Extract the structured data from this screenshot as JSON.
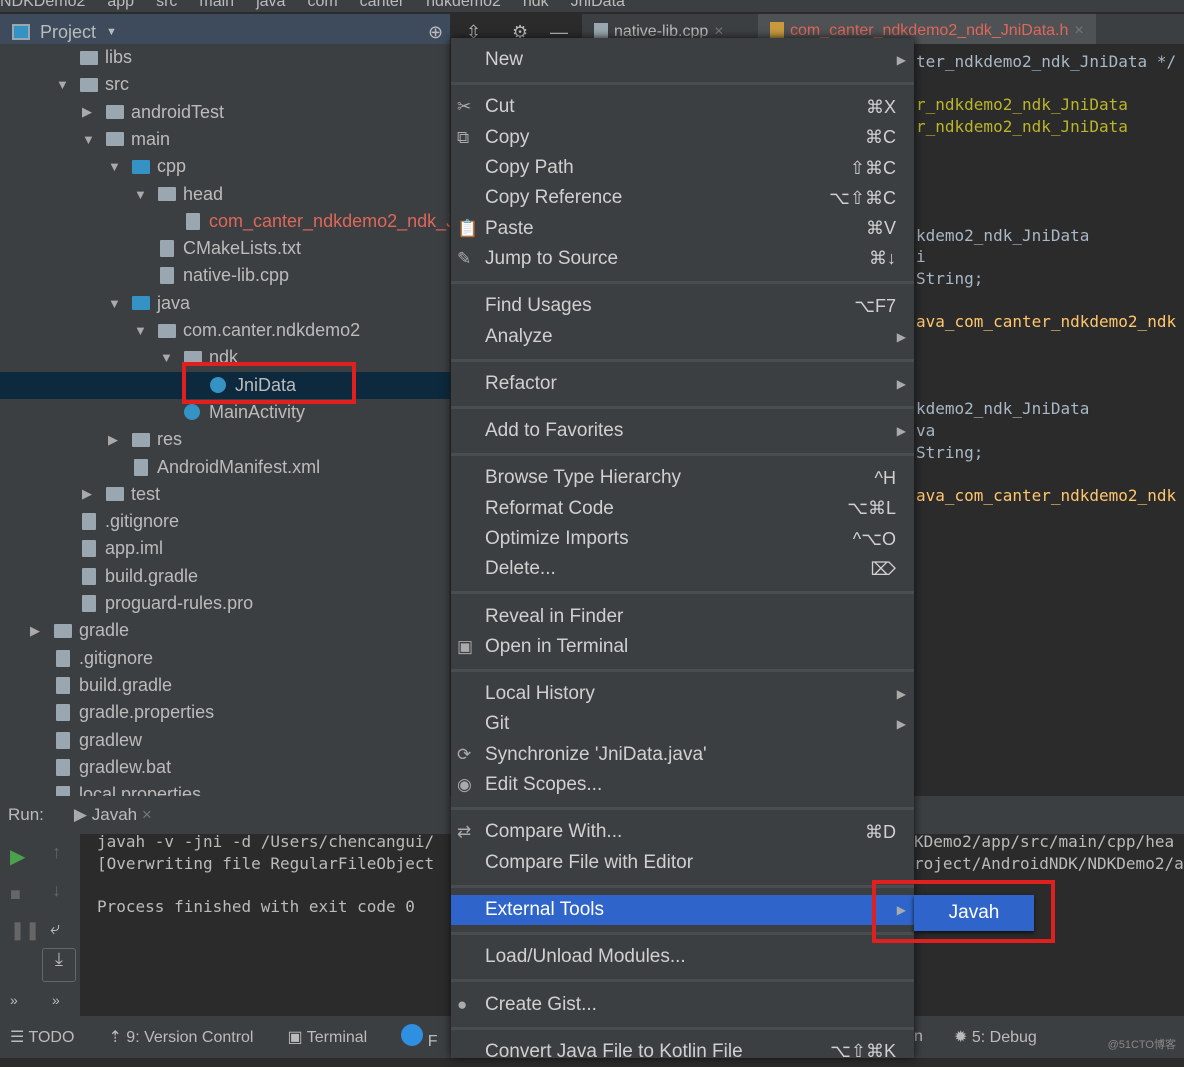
{
  "breadcrumbs": [
    "NDKDemo2",
    "app",
    "src",
    "main",
    "java",
    "com",
    "canter",
    "ndkdemo2",
    "ndk",
    "JniData"
  ],
  "project_panel": {
    "title": "Project"
  },
  "editor_tabs": [
    {
      "label": "native-lib.cpp",
      "active": false
    },
    {
      "label": "com_canter_ndkdemo2_ndk_JniData.h",
      "active": true,
      "color": "#e0665a"
    }
  ],
  "tree": [
    {
      "label": "libs",
      "depth": 2,
      "arrow": ""
    },
    {
      "label": "src",
      "depth": 2,
      "arrow": "▼"
    },
    {
      "label": "androidTest",
      "depth": 3,
      "arrow": "▶"
    },
    {
      "label": "main",
      "depth": 3,
      "arrow": "▼"
    },
    {
      "label": "cpp",
      "depth": 4,
      "arrow": "▼",
      "folder": "blue"
    },
    {
      "label": "head",
      "depth": 5,
      "arrow": "▼"
    },
    {
      "label": "com_canter_ndkdemo2_ndk_JniData.h",
      "depth": 6,
      "arrow": "",
      "color": "#e0665a",
      "file": true
    },
    {
      "label": "CMakeLists.txt",
      "depth": 5,
      "arrow": "",
      "file": true
    },
    {
      "label": "native-lib.cpp",
      "depth": 5,
      "arrow": "",
      "file": true
    },
    {
      "label": "java",
      "depth": 4,
      "arrow": "▼",
      "folder": "blue"
    },
    {
      "label": "com.canter.ndkdemo2",
      "depth": 5,
      "arrow": "▼"
    },
    {
      "label": "ndk",
      "depth": 6,
      "arrow": "▼"
    },
    {
      "label": "JniData",
      "depth": 7,
      "arrow": "",
      "selected": true,
      "cls": true
    },
    {
      "label": "MainActivity",
      "depth": 6,
      "arrow": "",
      "cls": true
    },
    {
      "label": "res",
      "depth": 4,
      "arrow": "▶"
    },
    {
      "label": "AndroidManifest.xml",
      "depth": 4,
      "arrow": "",
      "file": true
    },
    {
      "label": "test",
      "depth": 3,
      "arrow": "▶"
    },
    {
      "label": ".gitignore",
      "depth": 2,
      "arrow": "",
      "file": true
    },
    {
      "label": "app.iml",
      "depth": 2,
      "arrow": "",
      "file": true
    },
    {
      "label": "build.gradle",
      "depth": 2,
      "arrow": "",
      "file": true
    },
    {
      "label": "proguard-rules.pro",
      "depth": 2,
      "arrow": "",
      "file": true
    },
    {
      "label": "gradle",
      "depth": 1,
      "arrow": "▶"
    },
    {
      "label": ".gitignore",
      "depth": 1,
      "arrow": "",
      "file": true
    },
    {
      "label": "build.gradle",
      "depth": 1,
      "arrow": "",
      "file": true
    },
    {
      "label": "gradle.properties",
      "depth": 1,
      "arrow": "",
      "file": true
    },
    {
      "label": "gradlew",
      "depth": 1,
      "arrow": "",
      "file": true
    },
    {
      "label": "gradlew.bat",
      "depth": 1,
      "arrow": "",
      "file": true
    },
    {
      "label": "local.properties",
      "depth": 1,
      "arrow": "",
      "file": true
    }
  ],
  "editor_lines": [
    {
      "text": "ter_ndkdemo2_ndk_JniData */",
      "color": "#a9b7c6"
    },
    {
      "text": "",
      "color": "#a9b7c6"
    },
    {
      "text": "r_ndkdemo2_ndk_JniData",
      "color": "#bbb529"
    },
    {
      "text": "r_ndkdemo2_ndk_JniData",
      "color": "#bbb529"
    },
    {
      "text": "",
      "color": "#a9b7c6"
    },
    {
      "text": "",
      "color": "#a9b7c6"
    },
    {
      "text": "",
      "color": "#a9b7c6"
    },
    {
      "text": "",
      "color": "#a9b7c6"
    },
    {
      "text": "kdemo2_ndk_JniData",
      "color": "#a9b7c6"
    },
    {
      "text": "i",
      "color": "#a9b7c6"
    },
    {
      "text": "String;",
      "color": "#a9b7c6"
    },
    {
      "text": "",
      "color": "#a9b7c6"
    },
    {
      "text": "ava_com_canter_ndkdemo2_ndk",
      "color": "#ffc66d"
    },
    {
      "text": "",
      "color": "#a9b7c6"
    },
    {
      "text": "",
      "color": "#a9b7c6"
    },
    {
      "text": "",
      "color": "#a9b7c6"
    },
    {
      "text": "kdemo2_ndk_JniData",
      "color": "#a9b7c6"
    },
    {
      "text": "va",
      "color": "#a9b7c6"
    },
    {
      "text": "String;",
      "color": "#a9b7c6"
    },
    {
      "text": "",
      "color": "#a9b7c6"
    },
    {
      "text": "ava_com_canter_ndkdemo2_ndk",
      "color": "#ffc66d"
    }
  ],
  "run": {
    "label": "Run:",
    "tab": "Javah",
    "output": [
      "javah -v -jni -d /Users/chencangui/",
      "[Overwriting file RegularFileObject",
      "",
      "Process finished with exit code 0"
    ],
    "output_right": [
      "KDemo2/app/src/main/cpp/hea",
      "roject/AndroidNDK/NDKDemo2/a"
    ]
  },
  "status_bar": [
    "TODO",
    "9: Version Control",
    "Terminal",
    "F"
  ],
  "status_bar_right": [
    "n",
    "5: Debug"
  ],
  "context_menu": [
    {
      "label": "New",
      "sub": true
    },
    {
      "sep": true
    },
    {
      "label": "Cut",
      "shortcut": "⌘X",
      "icon": "✂"
    },
    {
      "label": "Copy",
      "shortcut": "⌘C",
      "icon": "⧉"
    },
    {
      "label": "Copy Path",
      "shortcut": "⇧⌘C"
    },
    {
      "label": "Copy Reference",
      "shortcut": "⌥⇧⌘C"
    },
    {
      "label": "Paste",
      "shortcut": "⌘V",
      "icon": "📋"
    },
    {
      "label": "Jump to Source",
      "shortcut": "⌘↓",
      "icon": "✎"
    },
    {
      "sep": true
    },
    {
      "label": "Find Usages",
      "shortcut": "⌥F7"
    },
    {
      "label": "Analyze",
      "sub": true
    },
    {
      "sep": true
    },
    {
      "label": "Refactor",
      "sub": true
    },
    {
      "sep": true
    },
    {
      "label": "Add to Favorites",
      "sub": true
    },
    {
      "sep": true
    },
    {
      "label": "Browse Type Hierarchy",
      "shortcut": "^H"
    },
    {
      "label": "Reformat Code",
      "shortcut": "⌥⌘L"
    },
    {
      "label": "Optimize Imports",
      "shortcut": "^⌥O"
    },
    {
      "label": "Delete...",
      "shortcut": "⌦"
    },
    {
      "sep": true
    },
    {
      "label": "Reveal in Finder"
    },
    {
      "label": "Open in Terminal",
      "icon": "▣"
    },
    {
      "sep": true
    },
    {
      "label": "Local History",
      "sub": true
    },
    {
      "label": "Git",
      "sub": true
    },
    {
      "label": "Synchronize 'JniData.java'",
      "icon": "⟳"
    },
    {
      "label": "Edit Scopes...",
      "icon": "◉"
    },
    {
      "sep": true
    },
    {
      "label": "Compare With...",
      "shortcut": "⌘D",
      "icon": "⇄"
    },
    {
      "label": "Compare File with Editor"
    },
    {
      "sep": true
    },
    {
      "label": "External Tools",
      "sub": true,
      "highlight": true
    },
    {
      "sep": true
    },
    {
      "label": "Load/Unload Modules..."
    },
    {
      "sep": true
    },
    {
      "label": "Create Gist...",
      "icon": "●"
    },
    {
      "sep": true
    },
    {
      "label": "Convert Java File to Kotlin File",
      "shortcut": "⌥⇧⌘K"
    }
  ],
  "submenu": {
    "item": "Javah"
  },
  "watermark": "@51CTO博客",
  "colors": {
    "highlight": "#2f65ca",
    "annotation": "#e0201e"
  }
}
